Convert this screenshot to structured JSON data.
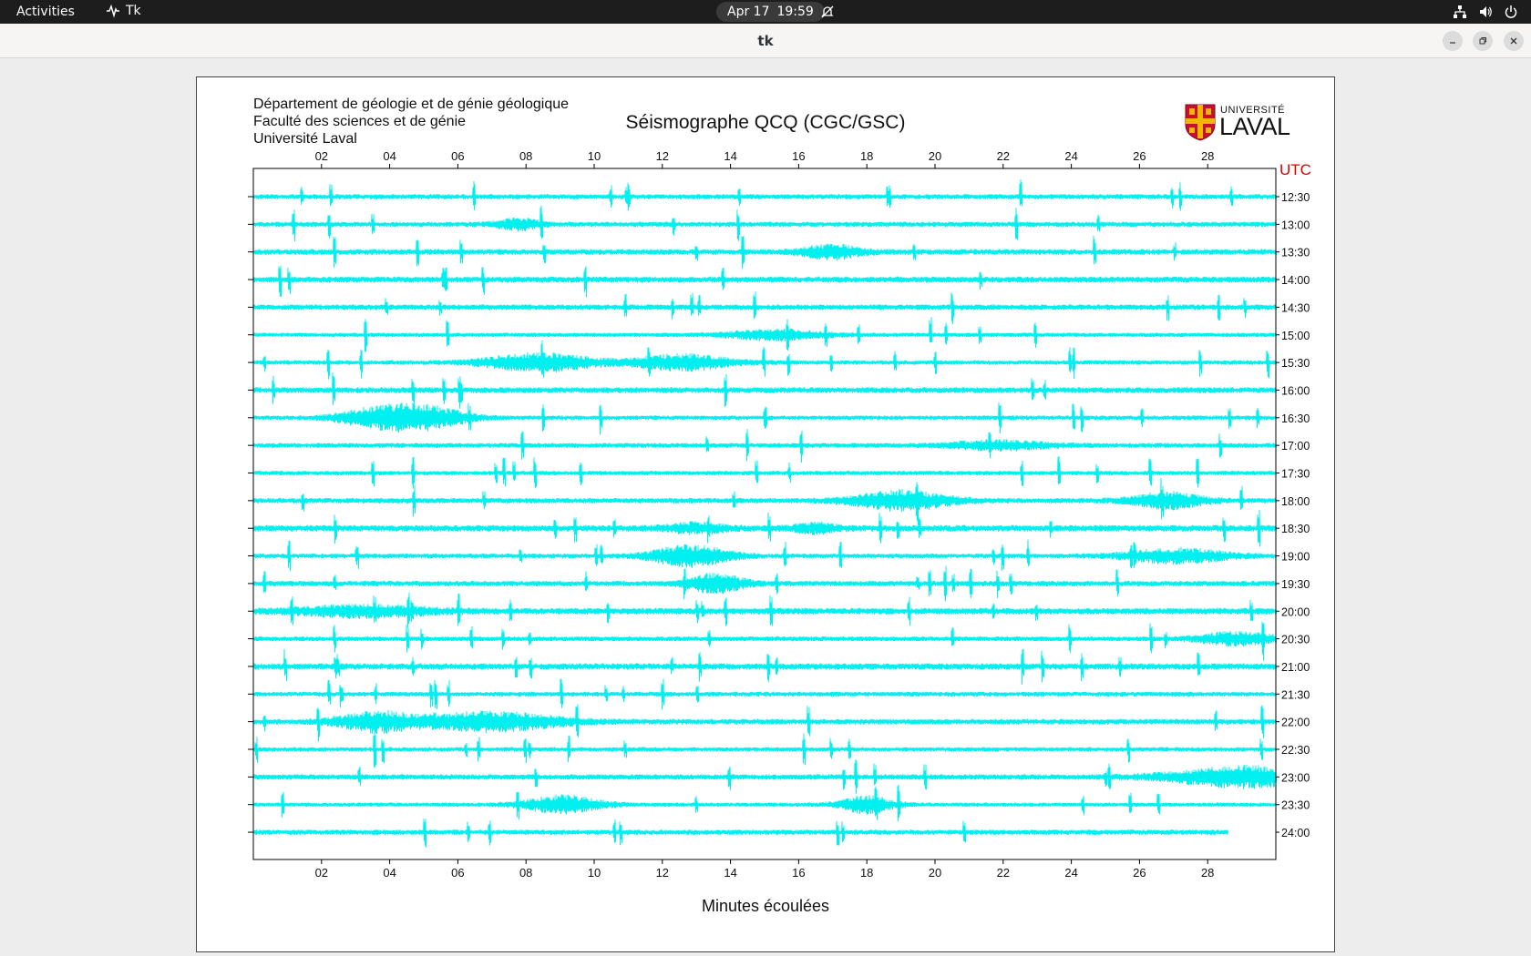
{
  "topbar": {
    "activities": "Activities",
    "app_name": "Tk",
    "date": "Apr 17",
    "time": "19:59"
  },
  "window": {
    "title": "tk"
  },
  "header": {
    "lines": [
      "Département de géologie et de génie géologique",
      "Faculté des sciences et de génie",
      "Université Laval"
    ],
    "title": "Séismographe QCQ (CGC/GSC)",
    "logo_text_top": "UNIVERSITÉ",
    "logo_text_bottom": "LAVAL"
  },
  "colors": {
    "trace": "#00f0f0",
    "utc_label": "#e00000",
    "logo_red": "#c8102e",
    "logo_gold": "#f2b705"
  },
  "chart_data": {
    "type": "line",
    "title": "Séismographe QCQ (CGC/GSC)",
    "xlabel": "Minutes écoulées",
    "ylabel": "UTC",
    "x_ticks": [
      "02",
      "04",
      "06",
      "08",
      "10",
      "12",
      "14",
      "16",
      "18",
      "20",
      "22",
      "24",
      "26",
      "28"
    ],
    "x_tick_values": [
      2,
      4,
      6,
      8,
      10,
      12,
      14,
      16,
      18,
      20,
      22,
      24,
      26,
      28
    ],
    "xlim": [
      0,
      30
    ],
    "rows": [
      "12:30",
      "13:00",
      "13:30",
      "14:00",
      "14:30",
      "15:00",
      "15:30",
      "16:00",
      "16:30",
      "17:00",
      "17:30",
      "18:00",
      "18:30",
      "19:00",
      "19:30",
      "20:00",
      "20:30",
      "21:00",
      "21:30",
      "22:00",
      "22:30",
      "23:00",
      "23:30",
      "24:00"
    ],
    "last_row_end_minute": 28.6
  }
}
